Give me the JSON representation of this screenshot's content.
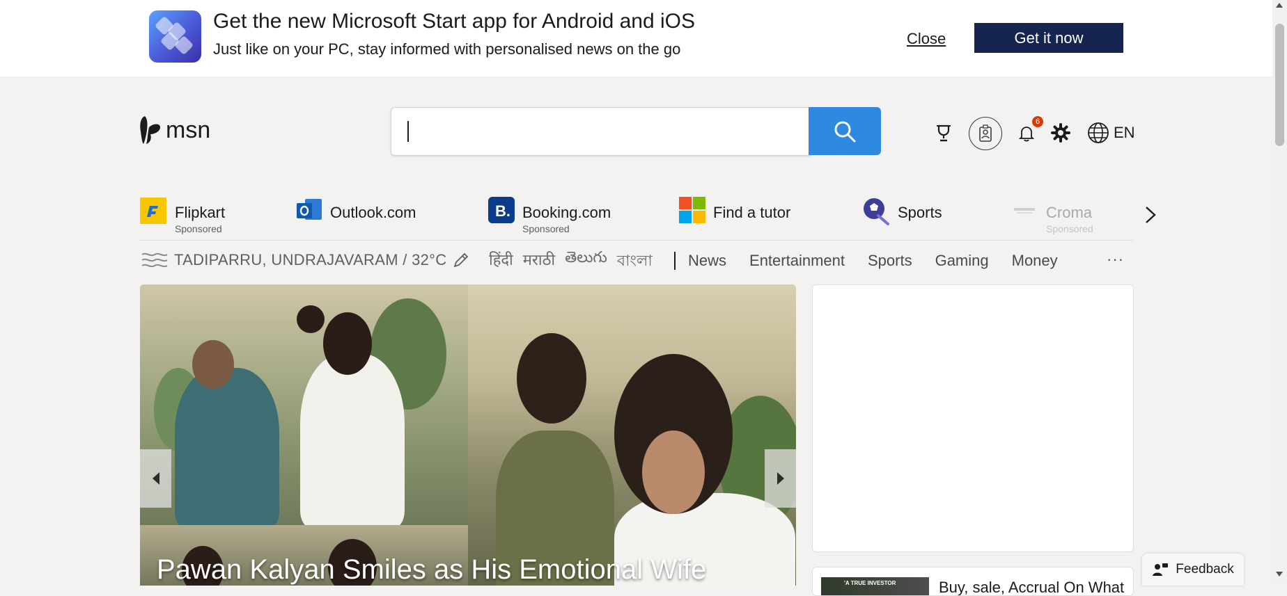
{
  "banner": {
    "title": "Get the new Microsoft Start app for Android and iOS",
    "subtitle": "Just like on your PC, stay informed with personalised news on the go",
    "close_label": "Close",
    "cta_label": "Get it now"
  },
  "header": {
    "logo_text": "msn",
    "search_placeholder": "",
    "notification_count": "6",
    "language": "EN"
  },
  "quick_links": [
    {
      "label": "Flipkart",
      "sponsored": "Sponsored"
    },
    {
      "label": "Outlook.com",
      "sponsored": ""
    },
    {
      "label": "Booking.com",
      "sponsored": "Sponsored"
    },
    {
      "label": "Find a tutor",
      "sponsored": ""
    },
    {
      "label": "Sports",
      "sponsored": ""
    },
    {
      "label": "Croma",
      "sponsored": "Sponsored"
    }
  ],
  "weather": {
    "location": "TADIPARRU, UNDRAJAVARAM / 32°C"
  },
  "languages": [
    "हिंदी",
    "मराठी",
    "తెలుగు",
    "বাংলা"
  ],
  "nav": [
    "News",
    "Entertainment",
    "Sports",
    "Gaming",
    "Money"
  ],
  "hero": {
    "headline": "Pawan Kalyan Smiles as His Emotional Wife"
  },
  "side_news": {
    "headline": "Buy, sale, Accrual On What",
    "thumb_label": "'A TRUE INVESTOR"
  },
  "feedback": {
    "label": "Feedback"
  },
  "colors": {
    "banner_cta": "#15254f",
    "search_button": "#2d8ae0",
    "badge": "#d83b01",
    "page_bg": "#f3f2f1"
  }
}
